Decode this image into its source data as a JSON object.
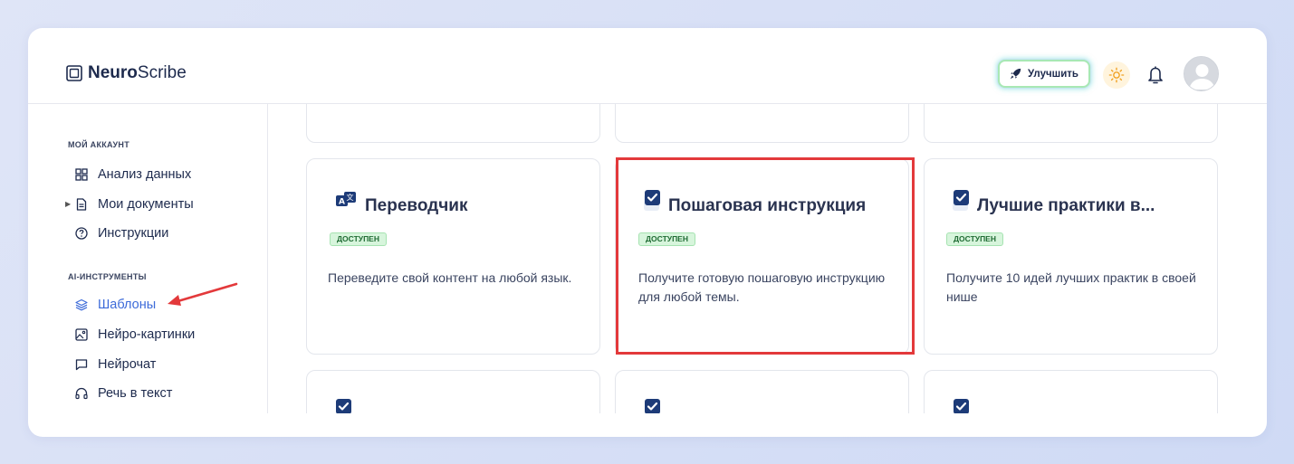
{
  "app": {
    "logo_bold": "Neuro",
    "logo_light": "Scribe"
  },
  "header": {
    "upgrade_label": "Улучшить"
  },
  "sidebar": {
    "section1_title": "МОЙ АККАУНТ",
    "section2_title": "AI-ИНСТРУМЕНТЫ",
    "items": [
      {
        "label": "Анализ данных",
        "icon": "grid-icon"
      },
      {
        "label": "Мои документы",
        "icon": "document-icon"
      },
      {
        "label": "Инструкции",
        "icon": "help-circle-icon"
      },
      {
        "label": "Шаблоны",
        "icon": "layers-icon",
        "active": true
      },
      {
        "label": "Нейро-картинки",
        "icon": "image-icon"
      },
      {
        "label": "Нейрочат",
        "icon": "chat-icon"
      },
      {
        "label": "Речь в текст",
        "icon": "headphones-icon"
      }
    ]
  },
  "cards": [
    {
      "title": "Переводчик",
      "badge": "ДОСТУПЕН",
      "desc": "Переведите свой контент на любой язык.",
      "icon": "translate-icon"
    },
    {
      "title": "Пошаговая инструкция",
      "badge": "ДОСТУПЕН",
      "desc": "Получите готовую пошаговую инструкцию для любой темы.",
      "icon": "checkbox-icon"
    },
    {
      "title": "Лучшие практики в...",
      "badge": "ДОСТУПЕН",
      "desc": "Получите 10 идей лучших практик в своей нише",
      "icon": "checkbox-icon"
    }
  ],
  "colors": {
    "accent": "#3d6bd9",
    "highlight": "#e3393b",
    "badge_bg": "#d7f5dc"
  }
}
